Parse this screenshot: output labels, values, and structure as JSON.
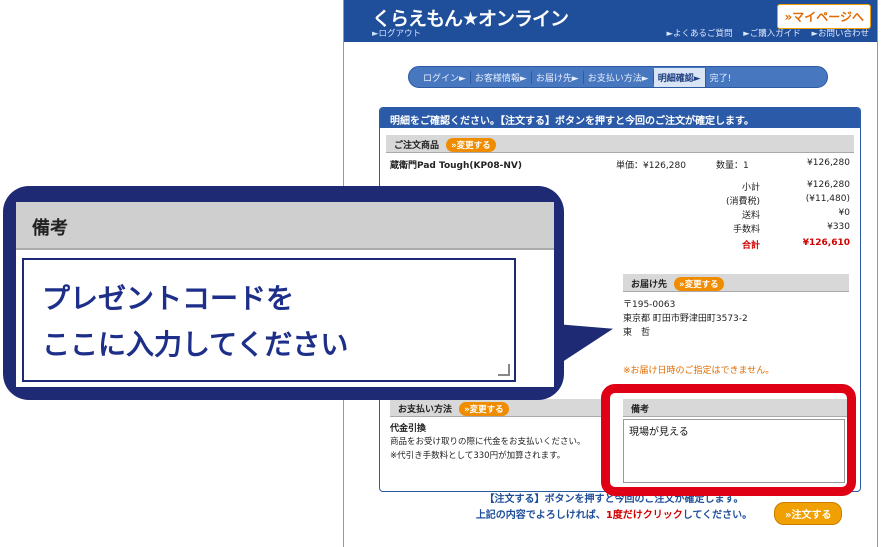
{
  "header": {
    "logo": "くらえもん★オンライン",
    "mypage": "»マイページへ",
    "logout": "►ログアウト",
    "links": [
      "►よくあるご質問",
      "►ご購入ガイド",
      "►お問い合わせ"
    ]
  },
  "steps": [
    "ログイン►",
    "お客様情報►",
    "お届け先►",
    "お支払い方法►",
    "明細確認►",
    "完了!"
  ],
  "confirm_header": "明細をご確認ください。【注文する】ボタンを押すと今回のご注文が確定します。",
  "order": {
    "section_label": "ご注文商品",
    "change_label": "»変更する",
    "product": "蔵衛門Pad Tough(KP08-NV)",
    "unit_price": "単価：¥126,280",
    "quantity": "数量：1",
    "line_total": "¥126,280",
    "summary": [
      {
        "label": "小計",
        "value": "¥126,280"
      },
      {
        "label": "(消費税)",
        "value": "(¥11,480)"
      },
      {
        "label": "送料",
        "value": "¥0"
      },
      {
        "label": "手数料",
        "value": "¥330"
      }
    ],
    "total_label": "合計",
    "total_value": "¥126,610"
  },
  "delivery": {
    "section_label": "お届け先",
    "change_label": "»変更する",
    "zip": "〒195-0063",
    "address": "東京都 町田市野津田町3573-2",
    "name": "東　哲",
    "note": "※お届け日時のご指定はできません。"
  },
  "payment": {
    "section_label": "お支払い方法",
    "change_label": "»変更する",
    "method": "代金引換",
    "desc1": "商品をお受け取りの際に代金をお支払いください。",
    "desc2": "※代引き手数料として330円が加算されます。"
  },
  "memo": {
    "section_label": "備考",
    "value": "現場が見える"
  },
  "bottom": {
    "line1": "【注文する】ボタンを押すと今回のご注文が確定します。",
    "line2a": "上記の内容でよろしければ、",
    "line2b": "1度だけクリック",
    "line2c": "してください。",
    "order_button": "»注文する"
  },
  "callout": {
    "title": "備考",
    "line1": "プレゼントコードを",
    "line2": "ここに入力してください"
  }
}
